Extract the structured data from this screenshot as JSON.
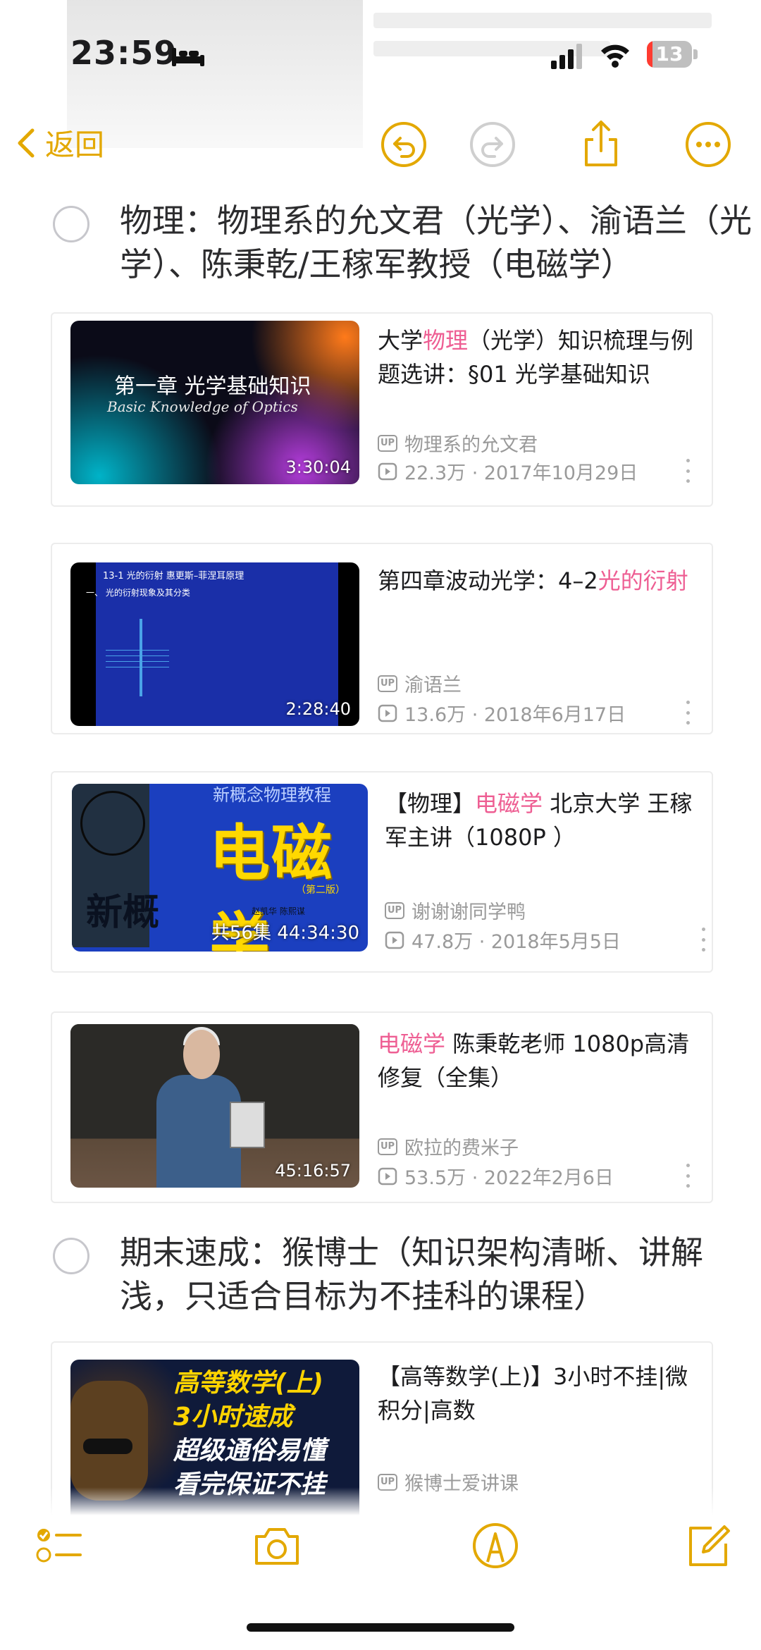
{
  "status_bar": {
    "time": "23:59",
    "battery": "13",
    "battery_level": 0.13
  },
  "nav": {
    "back_label": "返回",
    "accent_color": "#e3a800"
  },
  "icons": [
    "bed-icon",
    "signal-icon",
    "wifi-icon",
    "battery-icon",
    "back-chevron-icon",
    "undo-icon",
    "redo-icon",
    "share-icon",
    "more-icon",
    "checklist-icon",
    "camera-icon",
    "markup-icon",
    "compose-icon",
    "up-badge-icon",
    "play-count-icon"
  ],
  "sections": [
    {
      "heading": "物理：物理系的允文君（光学）、渝语兰（光学）、陈秉乾/王稼军教授（电磁学）"
    },
    {
      "heading": "期末速成：猴博士（知识架构清晰、讲解浅，只适合目标为不挂科的课程）"
    }
  ],
  "cards": [
    {
      "title_pre": "大学",
      "title_hl": "物理",
      "title_post": "（光学）知识梳理与例题选讲：§01 光学基础知识",
      "duration": "3:30:04",
      "uploader": "物理系的允文君",
      "stats": "22.3万 · 2017年10月29日",
      "thumb": {
        "line1": "第一章 光学基础知识",
        "line2": "Basic Knowledge of Optics"
      }
    },
    {
      "title_pre": "第四章波动光学：4–2",
      "title_hl": "光的衍射",
      "title_post": "",
      "duration": "2:28:40",
      "uploader": "渝语兰",
      "stats": "13.6万 · 2018年6月17日",
      "thumb": {
        "line1": "13-1  光的衍射  惠更斯–菲涅耳原理",
        "line2": "一、 光的衍射现象及其分类"
      }
    },
    {
      "title_pre": "【物理】",
      "title_hl": "电磁学",
      "title_post": " 北京大学 王稼军主讲（1080P ）",
      "duration": "共56集 44:34:30",
      "uploader": "谢谢谢同学鸭",
      "stats": "47.8万 · 2018年5月5日",
      "thumb": {
        "top": "新概念物理教程",
        "big": "电磁学",
        "edition": "（第二版）",
        "authors": "赵凯华  陈熙谋",
        "side": "新概"
      }
    },
    {
      "title_pre": "",
      "title_hl": "电磁学",
      "title_post": " 陈秉乾老师 1080p高清修复（全集）",
      "duration": "45:16:57",
      "uploader": "欧拉的费米子",
      "stats": "53.5万 · 2022年2月6日"
    },
    {
      "title_pre": "【高等数学(上)】3小时不挂|微积分|高数",
      "title_hl": "",
      "title_post": "",
      "uploader": "猴博士爱讲课",
      "thumb": {
        "y1": "高等数学(上)",
        "y2": "3小时速成",
        "w1": "超级通俗易懂",
        "w2": "看完保证不挂"
      }
    }
  ],
  "badge": {
    "up": "UP"
  },
  "highlight_color": "#ee5e93"
}
